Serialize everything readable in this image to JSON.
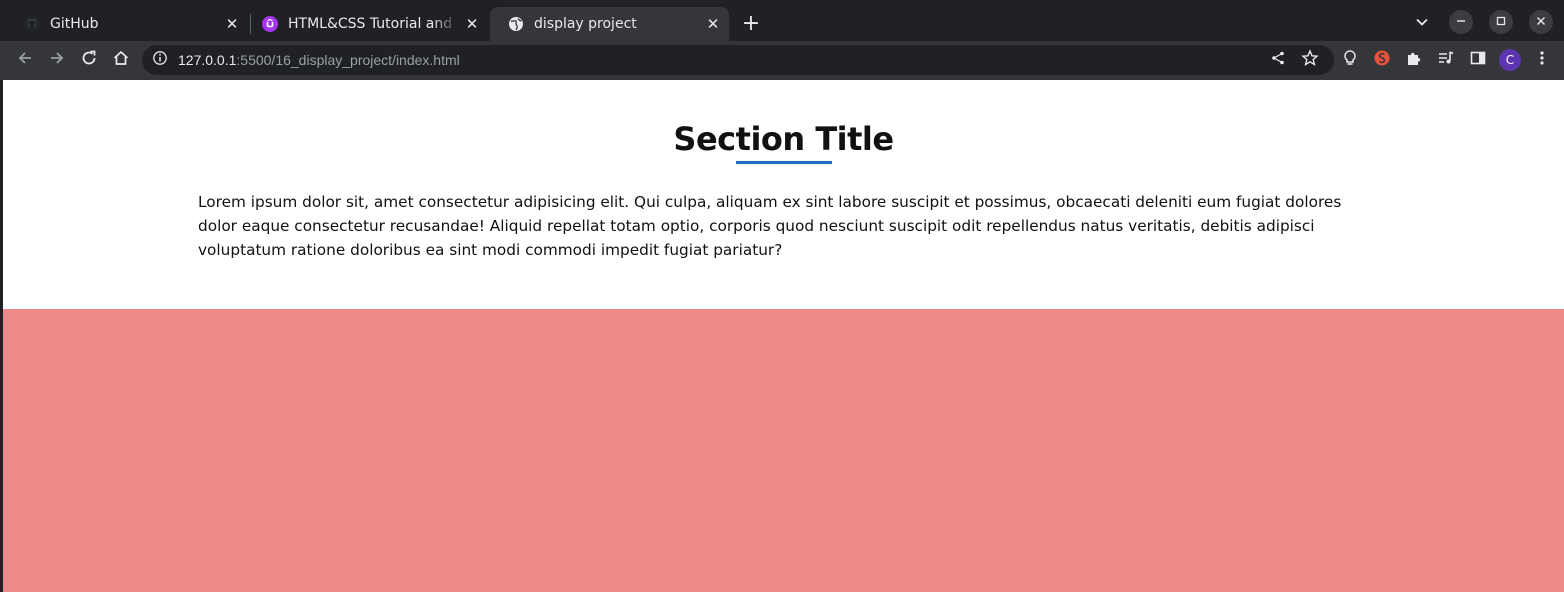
{
  "browser": {
    "tabs": [
      {
        "title": "GitHub",
        "icon": "github-icon"
      },
      {
        "title": "HTML&CSS Tutorial and Projects",
        "icon": "udemy-icon"
      },
      {
        "title": "display project",
        "icon": "globe-icon",
        "active": true
      }
    ],
    "url_host": "127.0.0.1",
    "url_rest": ":5500/16_display_project/index.html",
    "profile_initial": "C"
  },
  "page": {
    "section_title": "Section Title",
    "paragraph": "Lorem ipsum dolor sit, amet consectetur adipisicing elit. Qui culpa, aliquam ex sint labore suscipit et possimus, obcaecati deleniti eum fugiat dolores dolor eaque consectetur recusandae! Aliquid repellat totam optio, corporis quod nesciunt suscipit odit repellendus natus veritatis, debitis adipisci voluptatum ratione doloribus ea sint modi commodi impedit fugiat pariatur?",
    "underline_color": "#1d6fc1",
    "block_color": "#ef8a8a"
  }
}
